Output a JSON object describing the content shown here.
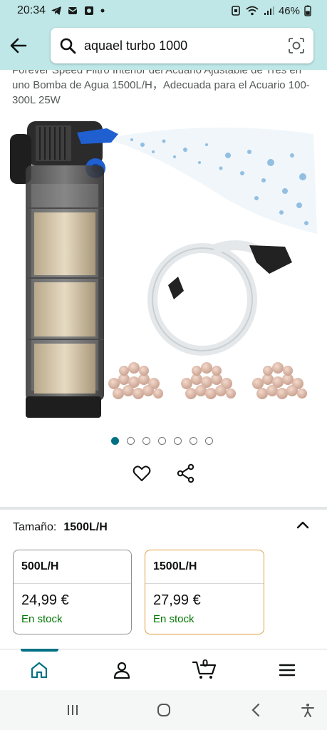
{
  "status_bar": {
    "time": "20:34",
    "battery": "46%"
  },
  "search": {
    "query": "aquael turbo 1000"
  },
  "product": {
    "title": "Forever Speed Filtro Interior del Acuario Ajustable de Tres en uno Bomba de Agua 1500L/H，Adecuada para el Acuario 100-300L 25W",
    "image_count": 7,
    "active_image": 0
  },
  "size_selector": {
    "label": "Tamaño:",
    "selected": "1500L/H",
    "options": [
      {
        "name": "500L/H",
        "price": "24,99 €",
        "stock": "En stock",
        "selected": false
      },
      {
        "name": "1500L/H",
        "price": "27,99 €",
        "stock": "En stock",
        "selected": true
      }
    ]
  },
  "bottom_nav": {
    "cart_count": "0",
    "active": "home"
  },
  "colors": {
    "header_bg": "#bfe7e7",
    "accent_teal": "#007185",
    "stock_green": "#007600",
    "selected_border": "#e39a3b"
  },
  "icons": [
    "back-arrow-icon",
    "search-icon",
    "camera-lens-icon",
    "heart-icon",
    "share-icon",
    "chevron-up-icon",
    "home-icon",
    "account-icon",
    "cart-icon",
    "menu-icon"
  ]
}
